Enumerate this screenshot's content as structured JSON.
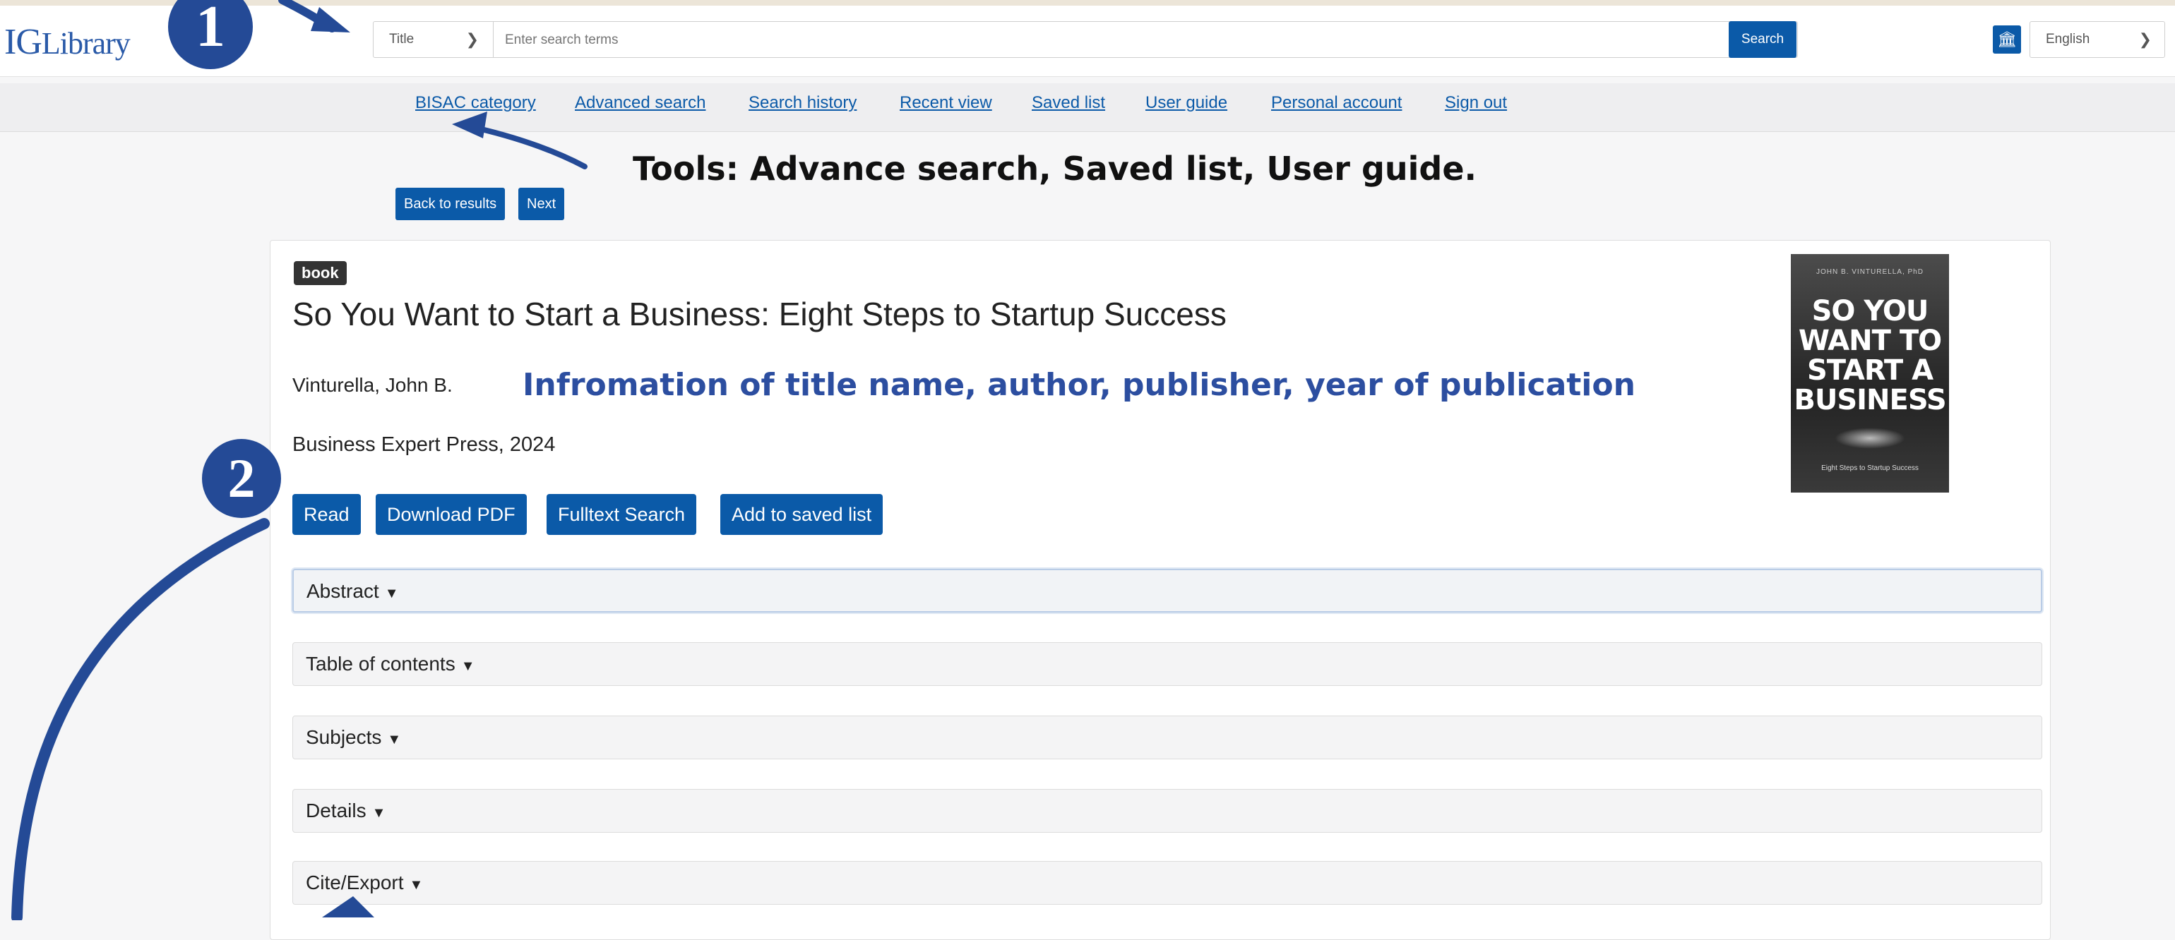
{
  "header": {
    "logo_ig": "IG",
    "logo_library": "Library",
    "search_type": "Title",
    "search_placeholder": "Enter search terms",
    "search_button": "Search",
    "language": "English"
  },
  "nav": {
    "links": [
      "BISAC category",
      "Advanced search",
      "Search history",
      "Recent view",
      "Saved list",
      "User guide",
      "Personal account",
      "Sign out"
    ]
  },
  "annotations": {
    "badge_1": "1",
    "badge_2": "2",
    "tools_note": "Tools: Advance search, Saved list, User guide.",
    "info_note": "Infromation of title name, author, publisher, year of publication"
  },
  "pager": {
    "back": "Back to results",
    "next": "Next"
  },
  "record": {
    "type": "book",
    "title": "So You Want to Start a Business: Eight Steps to Startup Success",
    "author": "Vinturella, John B.",
    "publisher": "Business Expert Press, 2024",
    "actions": [
      "Read",
      "Download PDF",
      "Fulltext Search",
      "Add to saved list"
    ],
    "cover": {
      "author_line": "JOHN B. VINTURELLA, PhD",
      "title": "SO YOU WANT TO START A BUSINESS",
      "subtitle": "Eight Steps to Startup Success"
    }
  },
  "sections": [
    "Abstract",
    "Table of contents",
    "Subjects",
    "Details",
    "Cite/Export"
  ],
  "colors": {
    "primary": "#0b5aa8",
    "annotation": "#244a96",
    "annotation_text": "#2c4ea0"
  }
}
